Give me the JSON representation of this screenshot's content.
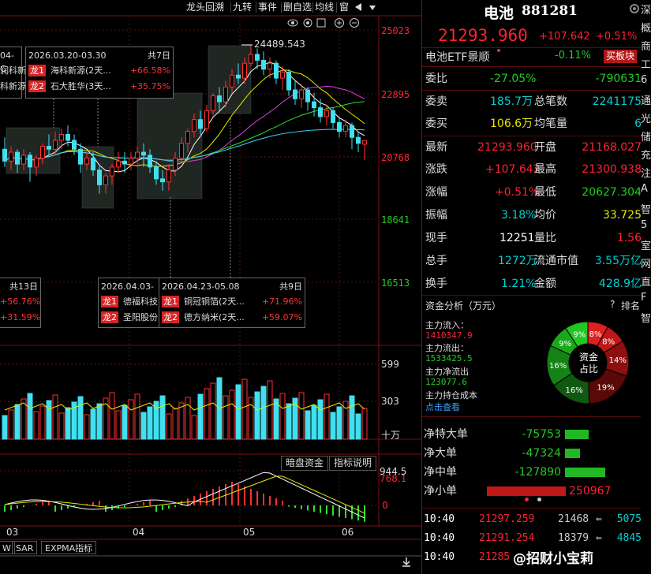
{
  "toolbar": {
    "items": [
      "龙头回溯",
      "九转",
      "事件",
      "删自选",
      "均线",
      "窗"
    ],
    "icons": [
      "eye-icon",
      "settings-icon",
      "plus-circle-icon",
      "minus-circle-icon",
      "back-arrow-icon",
      "dropdown-icon"
    ]
  },
  "y_axis": {
    "labels": [
      "25023",
      "22895",
      "20768",
      "18641",
      "16513"
    ]
  },
  "volume_axis": {
    "labels": [
      "599",
      "303"
    ],
    "unit": "十万"
  },
  "macd_axis": {
    "labels": [
      "944.5",
      "768.1",
      "0"
    ]
  },
  "peak_label": "24489.543",
  "x_axis": {
    "labels": [
      "03",
      "04",
      "05",
      "06"
    ]
  },
  "boxes": [
    {
      "date": "04-C",
      "count": "",
      "rows": [
        {
          "tag": "",
          "name": "润科新能",
          "pct": ""
        },
        {
          "tag": "",
          "name": "科新源",
          "pct": ""
        }
      ]
    },
    {
      "date": "2026.03.20-03.30",
      "count": "共7日",
      "rows": [
        {
          "tag": "龙1",
          "name": "海科新源(2天...",
          "pct": "+66.58%"
        },
        {
          "tag": "龙2",
          "name": "石大胜华(3天...",
          "pct": "+35.75%"
        }
      ]
    },
    {
      "date": "",
      "count": "共13日",
      "rows": [
        {
          "tag": "",
          "name": "",
          "pct": "+56.76%"
        },
        {
          "tag": "",
          "name": "",
          "pct": "+31.59%"
        }
      ]
    },
    {
      "date": "2026.04.03-0",
      "count": "",
      "rows": [
        {
          "tag": "龙1",
          "name": "德福科技",
          "pct": ""
        },
        {
          "tag": "龙2",
          "name": "圣阳股份",
          "pct": ""
        }
      ]
    },
    {
      "date": "2026.04.23-05.08",
      "count": "共9日",
      "rows": [
        {
          "tag": "龙1",
          "name": "铜冠铜箔(2天...",
          "pct": "+71.96%"
        },
        {
          "tag": "龙2",
          "name": "德方纳米(2天...",
          "pct": "+59.07%"
        }
      ]
    }
  ],
  "chart_buttons": {
    "dark_pool": "暗盘资金",
    "indicator_help": "指标说明"
  },
  "bottom_tabs": [
    "W",
    "SAR",
    "EXPMA指标"
  ],
  "header": {
    "name": "电池",
    "code": "881281",
    "price": "21293.960",
    "change": "+107.642",
    "change_pct": "+0.51%"
  },
  "etf": {
    "name": "电池ETF景顺",
    "pct": "-0.11%",
    "button": "买板块"
  },
  "quote": {
    "weibi_label": "委比",
    "weibi": "-27.05%",
    "weibi_val": "-790631",
    "weimai_label": "委卖",
    "weimai": "185.7万",
    "total_lbl": "总笔数",
    "total": "2241175",
    "weimai2_label": "委买",
    "weimai2": "106.6万",
    "avg_lbl": "均笔量",
    "avg": "6",
    "latest_lbl": "最新",
    "latest": "21293.960",
    "open_lbl": "开盘",
    "open": "21168.027",
    "chg_lbl": "涨跌",
    "chg": "+107.642",
    "high_lbl": "最高",
    "high": "21300.938",
    "chgpct_lbl": "涨幅",
    "chgpct": "+0.51%",
    "low_lbl": "最低",
    "low": "20627.304",
    "amp_lbl": "振幅",
    "amp": "3.18%",
    "avgp_lbl": "均价",
    "avgp": "33.725",
    "cur_lbl": "现手",
    "cur": "12251",
    "vr_lbl": "量比",
    "vr": "1.56",
    "totv_lbl": "总手",
    "totv": "1272万",
    "mcap_lbl": "流通市值",
    "mcap": "3.55万亿",
    "turn_lbl": "换手",
    "turn": "1.21%",
    "amt_lbl": "金额",
    "amt": "428.9亿"
  },
  "flow": {
    "title": "资金分析（万元）",
    "help": "?",
    "rank": "排名",
    "in_lbl": "主力流入：",
    "in": "1410347.9",
    "out_lbl": "主力流出：",
    "out": "1533425.5",
    "net_lbl": "主力净流出",
    "net": "123077.6",
    "cost_lbl": "主力持仓成本",
    "cost_link": "点击查看",
    "donut_center_1": "资金",
    "donut_center_2": "占比",
    "slices": [
      {
        "label": "8%",
        "value": 8,
        "color": "#e02020"
      },
      {
        "label": "8%",
        "value": 8,
        "color": "#c01818"
      },
      {
        "label": "14%",
        "value": 14,
        "color": "#8c1010"
      },
      {
        "label": "19%",
        "value": 19,
        "color": "#5a0808"
      },
      {
        "label": "16%",
        "value": 16,
        "color": "#0f5a10"
      },
      {
        "label": "16%",
        "value": 16,
        "color": "#148214"
      },
      {
        "label": "9%",
        "value": 9,
        "color": "#1aa81a"
      },
      {
        "label": "9%",
        "value": 9,
        "color": "#22c822"
      }
    ]
  },
  "orders": [
    {
      "label": "净特大单",
      "value": "-75753",
      "bar": 0.3,
      "color": "#22b822"
    },
    {
      "label": "净大单",
      "value": "-47324",
      "bar": 0.19,
      "color": "#22b822"
    },
    {
      "label": "净中单",
      "value": "-127890",
      "bar": 0.51,
      "color": "#22b822"
    },
    {
      "label": "净小单",
      "value": "250967",
      "bar": 1.0,
      "color": "#c01818"
    }
  ],
  "ticks": [
    {
      "time": "10:40",
      "price": "21297.259",
      "vol": "21468",
      "count": "5075"
    },
    {
      "time": "10:40",
      "price": "21291.254",
      "vol": "18379",
      "count": "4845"
    },
    {
      "time": "10:40",
      "price": "21285",
      "vol": "",
      "count": ""
    }
  ],
  "far_strip": [
    "深",
    "概",
    "商",
    "工",
    "6",
    "通",
    "光",
    "储",
    "充",
    "注",
    "A",
    "智",
    "5",
    "室",
    "网",
    "直",
    "F",
    "智"
  ],
  "watermark": "@招财小宝莉",
  "chart_data": {
    "type": "candlestick",
    "y_axis_labels": [
      "25023",
      "22895",
      "20768",
      "18641",
      "16513"
    ],
    "x_labels": [
      "03",
      "04",
      "05",
      "06"
    ],
    "ohlc_note": "approximate daily candles read from the chart",
    "candles": [
      [
        21000,
        20600,
        21400,
        20400
      ],
      [
        20600,
        20900,
        21100,
        20300
      ],
      [
        20900,
        20500,
        21000,
        20200
      ],
      [
        20500,
        20800,
        21000,
        20300
      ],
      [
        20800,
        20400,
        20900,
        19900
      ],
      [
        20400,
        20700,
        20800,
        20100
      ],
      [
        20700,
        21100,
        21200,
        20500
      ],
      [
        21100,
        21000,
        21500,
        20800
      ],
      [
        21000,
        21300,
        21600,
        20800
      ],
      [
        21300,
        21500,
        21700,
        21000
      ],
      [
        21500,
        21300,
        21800,
        21100
      ],
      [
        21300,
        21000,
        21500,
        20800
      ],
      [
        21000,
        20500,
        21200,
        20200
      ],
      [
        20500,
        20700,
        20900,
        20300
      ],
      [
        20700,
        20300,
        20900,
        20100
      ],
      [
        20300,
        19800,
        20500,
        19500
      ],
      [
        19800,
        20100,
        20200,
        19500
      ],
      [
        20100,
        20400,
        20500,
        19800
      ],
      [
        20400,
        20600,
        20900,
        20200
      ],
      [
        20600,
        20500,
        20900,
        20200
      ],
      [
        20500,
        20700,
        20900,
        20300
      ],
      [
        20700,
        20900,
        21100,
        20400
      ],
      [
        20900,
        20800,
        21200,
        20400
      ],
      [
        20800,
        20400,
        21000,
        20200
      ],
      [
        20400,
        20000,
        20600,
        19800
      ],
      [
        20000,
        19900,
        20300,
        19600
      ],
      [
        19900,
        20300,
        20500,
        19600
      ],
      [
        20300,
        20700,
        20900,
        20100
      ],
      [
        20700,
        21200,
        21400,
        20600
      ],
      [
        21200,
        21600,
        21700,
        20900
      ],
      [
        21600,
        22000,
        22200,
        21400
      ],
      [
        22000,
        21700,
        22300,
        21500
      ],
      [
        21700,
        22300,
        22500,
        21600
      ],
      [
        22300,
        22800,
        22900,
        22100
      ],
      [
        22800,
        22600,
        23100,
        22300
      ],
      [
        22600,
        23100,
        23300,
        22400
      ],
      [
        23100,
        23500,
        23700,
        22900
      ],
      [
        23500,
        23400,
        23900,
        23200
      ],
      [
        23400,
        23900,
        24100,
        23200
      ],
      [
        23900,
        24200,
        24489,
        23800
      ],
      [
        24200,
        24000,
        24400,
        23700
      ],
      [
        24000,
        23700,
        24300,
        23500
      ],
      [
        23700,
        23900,
        24100,
        23400
      ],
      [
        23900,
        23400,
        24000,
        23200
      ],
      [
        23400,
        23600,
        23800,
        23000
      ],
      [
        23600,
        23000,
        23700,
        22800
      ],
      [
        23000,
        22700,
        23300,
        22500
      ],
      [
        22700,
        23000,
        23200,
        22400
      ],
      [
        23000,
        22600,
        23100,
        22300
      ],
      [
        22600,
        22400,
        22900,
        22100
      ],
      [
        22400,
        22100,
        22700,
        21900
      ],
      [
        22100,
        22300,
        22500,
        21800
      ],
      [
        22300,
        21900,
        22400,
        21700
      ],
      [
        21900,
        21600,
        22100,
        21400
      ],
      [
        21600,
        21800,
        22000,
        21400
      ],
      [
        21800,
        21400,
        21900,
        21000
      ],
      [
        21400,
        21200,
        21600,
        20900
      ],
      [
        21168,
        21294,
        21301,
        20627
      ]
    ]
  }
}
